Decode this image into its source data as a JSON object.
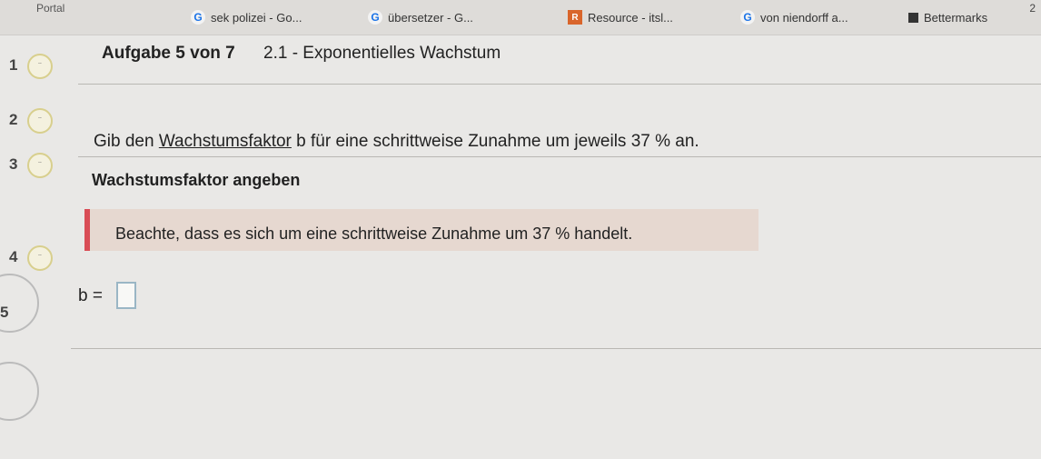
{
  "bookmarks": {
    "items": [
      {
        "label": "Portal"
      },
      {
        "label": "sek polizei - Go..."
      },
      {
        "label": "übersetzer - G..."
      },
      {
        "label": "Resource - itsl..."
      },
      {
        "label": "von niendorff a..."
      },
      {
        "label": "Bettermarks"
      }
    ]
  },
  "header": {
    "title": "Aufgabe 5 von 7",
    "subtitle": "2.1 - Exponentielles Wachstum"
  },
  "task": {
    "prefix": "Gib den ",
    "link": "Wachstumsfaktor",
    "suffix": " b für eine schrittweise Zunahme um jeweils 37 % an."
  },
  "section": {
    "title": "Wachstumsfaktor angeben"
  },
  "hint": {
    "text": "Beachte, dass es sich um eine schrittweise Zunahme um 37 % handelt."
  },
  "answer": {
    "label": "b =",
    "value": ""
  },
  "steps": [
    {
      "number": "1"
    },
    {
      "number": "2"
    },
    {
      "number": "3"
    },
    {
      "number": "4"
    },
    {
      "number": "5"
    }
  ],
  "icons": {
    "google": "G",
    "resource": "R",
    "bettermarks": "bettermarks-icon"
  },
  "corner": {
    "text": "2"
  }
}
